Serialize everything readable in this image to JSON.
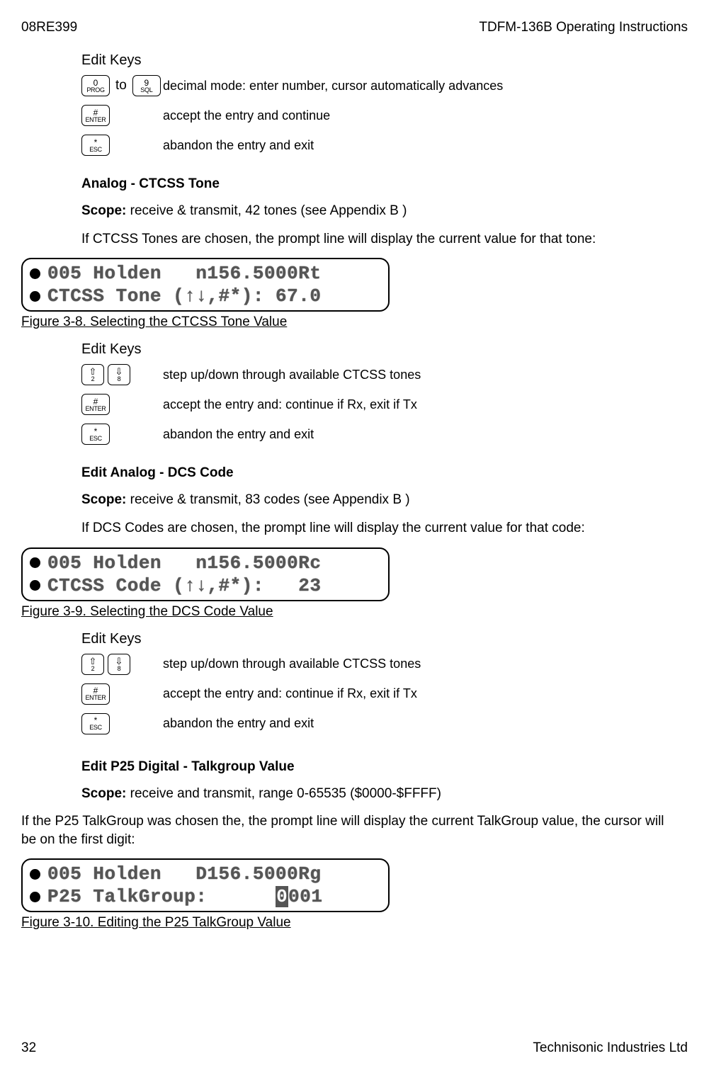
{
  "header": {
    "left": "08RE399",
    "right": "TDFM-136B Operating Instructions"
  },
  "edit_keys_sections": [
    {
      "title": "Edit Keys",
      "rows": [
        {
          "keys": [
            {
              "type": "dual",
              "top": "0",
              "bot": "PROG"
            },
            {
              "type": "word",
              "text": "to"
            },
            {
              "type": "dual",
              "top": "9",
              "bot": "SQL"
            }
          ],
          "desc": "decimal mode: enter number, cursor automatically advances"
        },
        {
          "keys": [
            {
              "type": "dual",
              "top": "#",
              "bot": "ENTER"
            }
          ],
          "desc": "accept the entry and continue"
        },
        {
          "keys": [
            {
              "type": "dual",
              "top": "*",
              "bot": "ESC"
            }
          ],
          "desc": "abandon the entry and exit"
        }
      ]
    },
    {
      "title": "Edit Keys",
      "rows": [
        {
          "keys": [
            {
              "type": "arrow",
              "top": "⇧",
              "bot": "2"
            },
            {
              "type": "arrow",
              "top": "⇩",
              "bot": "8"
            }
          ],
          "desc": "step up/down through available CTCSS tones"
        },
        {
          "keys": [
            {
              "type": "dual",
              "top": "#",
              "bot": "ENTER"
            }
          ],
          "desc": "accept the entry and: continue if Rx, exit if Tx"
        },
        {
          "keys": [
            {
              "type": "dual",
              "top": "*",
              "bot": "ESC"
            }
          ],
          "desc": "abandon the entry and exit"
        }
      ]
    },
    {
      "title": "Edit Keys",
      "rows": [
        {
          "keys": [
            {
              "type": "arrow",
              "top": "⇧",
              "bot": "2"
            },
            {
              "type": "arrow",
              "top": "⇩",
              "bot": "8"
            }
          ],
          "desc": "step up/down through available CTCSS tones"
        },
        {
          "keys": [
            {
              "type": "dual",
              "top": "#",
              "bot": "ENTER"
            }
          ],
          "desc": "accept the entry and: continue if Rx, exit if Tx"
        },
        {
          "keys": [
            {
              "type": "dual",
              "top": "*",
              "bot": "ESC"
            }
          ],
          "desc": "abandon the entry and exit"
        }
      ]
    }
  ],
  "sections": {
    "ctcss": {
      "heading": "Analog - CTCSS Tone",
      "scope_label": "Scope:",
      "scope_text": " receive & transmit,  42 tones (see Appendix B )",
      "para": "If CTCSS Tones  are chosen, the prompt line will display the current value for that tone:",
      "lcd_line1": "005 Holden   n156.5000Rt",
      "lcd_line2": "CTCSS Tone (↑↓,#*): 67.0",
      "caption": "Figure 3-8. Selecting the CTCSS Tone Value"
    },
    "dcs": {
      "heading": "Edit Analog - DCS Code",
      "scope_label": "Scope:",
      "scope_text": " receive & transmit, 83 codes (see Appendix B )",
      "para": "If DCS Codes are chosen, the prompt line will display the current value for that code:",
      "lcd_line1": "005 Holden   n156.5000Rc",
      "lcd_line2": "CTCSS Code (↑↓,#*):   23",
      "caption": "Figure 3-9. Selecting the DCS Code Value"
    },
    "p25": {
      "heading": "Edit P25 Digital - Talkgroup Value",
      "scope_label": "Scope:",
      "scope_text": " receive and transmit, range 0-65535 ($0000-$FFFF)",
      "para": "If the P25 TalkGroup was chosen the, the prompt line will display the current TalkGroup value, the cursor will be on the first digit:",
      "lcd_line1": "005 Holden   D156.5000Rg",
      "lcd_line2_pre": "P25 TalkGroup:      ",
      "lcd_line2_hl": "0",
      "lcd_line2_post": "001",
      "caption": "Figure 3-10. Editing the P25 TalkGroup Value"
    }
  },
  "footer": {
    "left": "32",
    "right": "Technisonic Industries Ltd"
  }
}
